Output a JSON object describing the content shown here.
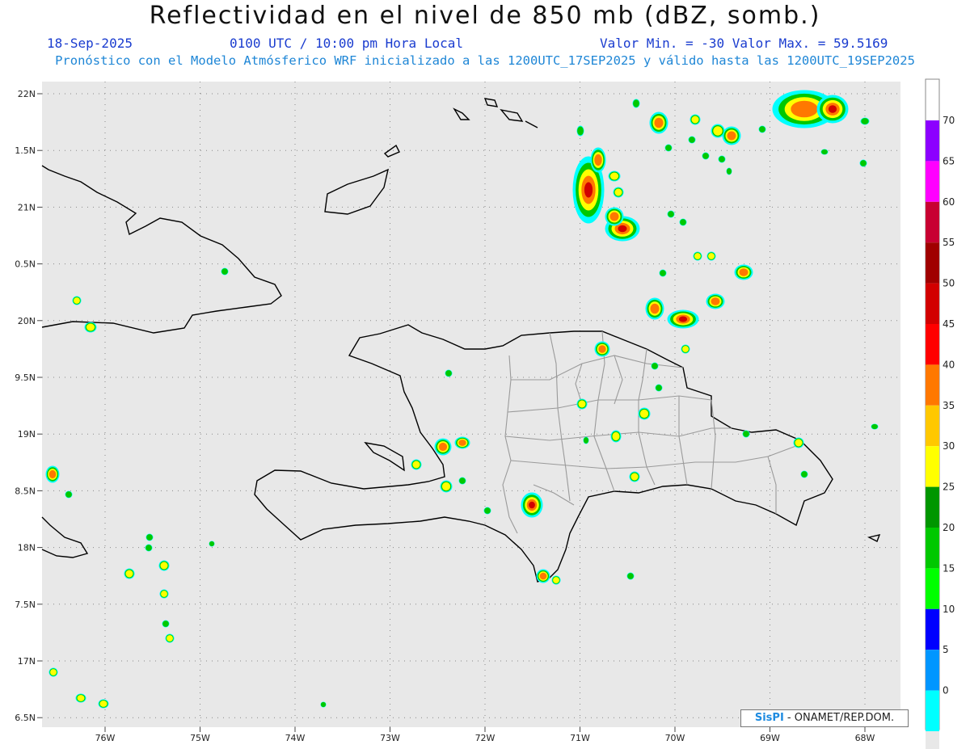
{
  "header": {
    "title": "Reflectividad en el nivel de 850 mb (dBZ, somb.)",
    "date": "18-Sep-2025",
    "time": "0100 UTC / 10:00 pm Hora Local",
    "range": "Valor Min. = -30  Valor Max. = 59.5169",
    "description": "Pronóstico con el Modelo Atmósferico WRF inicializado a las 1200UTC_17SEP2025 y válido hasta las  1200UTC_19SEP2025"
  },
  "map": {
    "lat_labels": [
      "22N",
      "1.5N",
      "21N",
      "0.5N",
      "20N",
      "9.5N",
      "19N",
      "8.5N",
      "18N",
      "7.5N",
      "17N",
      "6.5N"
    ],
    "lon_labels": [
      "76W",
      "75W",
      "74W",
      "73W",
      "72W",
      "71W",
      "70W",
      "69W",
      "68W"
    ],
    "background_color": "#e8e8e8"
  },
  "colorbar": {
    "ticks": [
      "70",
      "65",
      "60",
      "55",
      "50",
      "45",
      "40",
      "35",
      "30",
      "25",
      "20",
      "15",
      "10",
      "5",
      "0"
    ],
    "colors": [
      "#8c00ff",
      "#ff00ff",
      "#c80032",
      "#a00000",
      "#d20000",
      "#ff0000",
      "#ff7800",
      "#ffc800",
      "#ffff00",
      "#009600",
      "#00c800",
      "#00ff00",
      "#0000ff",
      "#0096ff",
      "#00ffff",
      "#e8e8e8"
    ]
  },
  "credit": {
    "logo": "SisPI",
    "text": "- ONAMET/REP.DOM."
  }
}
